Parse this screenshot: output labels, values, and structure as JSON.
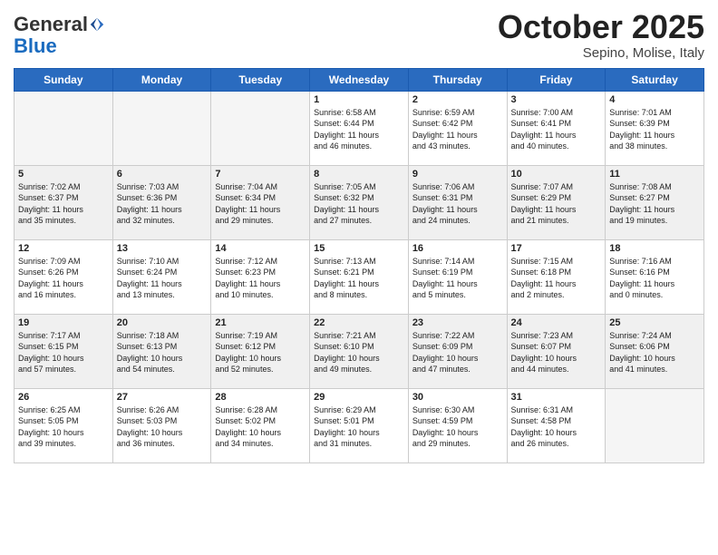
{
  "logo": {
    "general": "General",
    "blue": "Blue"
  },
  "title": {
    "month": "October 2025",
    "location": "Sepino, Molise, Italy"
  },
  "days_header": [
    "Sunday",
    "Monday",
    "Tuesday",
    "Wednesday",
    "Thursday",
    "Friday",
    "Saturday"
  ],
  "weeks": [
    [
      {
        "day": "",
        "info": ""
      },
      {
        "day": "",
        "info": ""
      },
      {
        "day": "",
        "info": ""
      },
      {
        "day": "1",
        "info": "Sunrise: 6:58 AM\nSunset: 6:44 PM\nDaylight: 11 hours\nand 46 minutes."
      },
      {
        "day": "2",
        "info": "Sunrise: 6:59 AM\nSunset: 6:42 PM\nDaylight: 11 hours\nand 43 minutes."
      },
      {
        "day": "3",
        "info": "Sunrise: 7:00 AM\nSunset: 6:41 PM\nDaylight: 11 hours\nand 40 minutes."
      },
      {
        "day": "4",
        "info": "Sunrise: 7:01 AM\nSunset: 6:39 PM\nDaylight: 11 hours\nand 38 minutes."
      }
    ],
    [
      {
        "day": "5",
        "info": "Sunrise: 7:02 AM\nSunset: 6:37 PM\nDaylight: 11 hours\nand 35 minutes."
      },
      {
        "day": "6",
        "info": "Sunrise: 7:03 AM\nSunset: 6:36 PM\nDaylight: 11 hours\nand 32 minutes."
      },
      {
        "day": "7",
        "info": "Sunrise: 7:04 AM\nSunset: 6:34 PM\nDaylight: 11 hours\nand 29 minutes."
      },
      {
        "day": "8",
        "info": "Sunrise: 7:05 AM\nSunset: 6:32 PM\nDaylight: 11 hours\nand 27 minutes."
      },
      {
        "day": "9",
        "info": "Sunrise: 7:06 AM\nSunset: 6:31 PM\nDaylight: 11 hours\nand 24 minutes."
      },
      {
        "day": "10",
        "info": "Sunrise: 7:07 AM\nSunset: 6:29 PM\nDaylight: 11 hours\nand 21 minutes."
      },
      {
        "day": "11",
        "info": "Sunrise: 7:08 AM\nSunset: 6:27 PM\nDaylight: 11 hours\nand 19 minutes."
      }
    ],
    [
      {
        "day": "12",
        "info": "Sunrise: 7:09 AM\nSunset: 6:26 PM\nDaylight: 11 hours\nand 16 minutes."
      },
      {
        "day": "13",
        "info": "Sunrise: 7:10 AM\nSunset: 6:24 PM\nDaylight: 11 hours\nand 13 minutes."
      },
      {
        "day": "14",
        "info": "Sunrise: 7:12 AM\nSunset: 6:23 PM\nDaylight: 11 hours\nand 10 minutes."
      },
      {
        "day": "15",
        "info": "Sunrise: 7:13 AM\nSunset: 6:21 PM\nDaylight: 11 hours\nand 8 minutes."
      },
      {
        "day": "16",
        "info": "Sunrise: 7:14 AM\nSunset: 6:19 PM\nDaylight: 11 hours\nand 5 minutes."
      },
      {
        "day": "17",
        "info": "Sunrise: 7:15 AM\nSunset: 6:18 PM\nDaylight: 11 hours\nand 2 minutes."
      },
      {
        "day": "18",
        "info": "Sunrise: 7:16 AM\nSunset: 6:16 PM\nDaylight: 11 hours\nand 0 minutes."
      }
    ],
    [
      {
        "day": "19",
        "info": "Sunrise: 7:17 AM\nSunset: 6:15 PM\nDaylight: 10 hours\nand 57 minutes."
      },
      {
        "day": "20",
        "info": "Sunrise: 7:18 AM\nSunset: 6:13 PM\nDaylight: 10 hours\nand 54 minutes."
      },
      {
        "day": "21",
        "info": "Sunrise: 7:19 AM\nSunset: 6:12 PM\nDaylight: 10 hours\nand 52 minutes."
      },
      {
        "day": "22",
        "info": "Sunrise: 7:21 AM\nSunset: 6:10 PM\nDaylight: 10 hours\nand 49 minutes."
      },
      {
        "day": "23",
        "info": "Sunrise: 7:22 AM\nSunset: 6:09 PM\nDaylight: 10 hours\nand 47 minutes."
      },
      {
        "day": "24",
        "info": "Sunrise: 7:23 AM\nSunset: 6:07 PM\nDaylight: 10 hours\nand 44 minutes."
      },
      {
        "day": "25",
        "info": "Sunrise: 7:24 AM\nSunset: 6:06 PM\nDaylight: 10 hours\nand 41 minutes."
      }
    ],
    [
      {
        "day": "26",
        "info": "Sunrise: 6:25 AM\nSunset: 5:05 PM\nDaylight: 10 hours\nand 39 minutes."
      },
      {
        "day": "27",
        "info": "Sunrise: 6:26 AM\nSunset: 5:03 PM\nDaylight: 10 hours\nand 36 minutes."
      },
      {
        "day": "28",
        "info": "Sunrise: 6:28 AM\nSunset: 5:02 PM\nDaylight: 10 hours\nand 34 minutes."
      },
      {
        "day": "29",
        "info": "Sunrise: 6:29 AM\nSunset: 5:01 PM\nDaylight: 10 hours\nand 31 minutes."
      },
      {
        "day": "30",
        "info": "Sunrise: 6:30 AM\nSunset: 4:59 PM\nDaylight: 10 hours\nand 29 minutes."
      },
      {
        "day": "31",
        "info": "Sunrise: 6:31 AM\nSunset: 4:58 PM\nDaylight: 10 hours\nand 26 minutes."
      },
      {
        "day": "",
        "info": ""
      }
    ]
  ]
}
